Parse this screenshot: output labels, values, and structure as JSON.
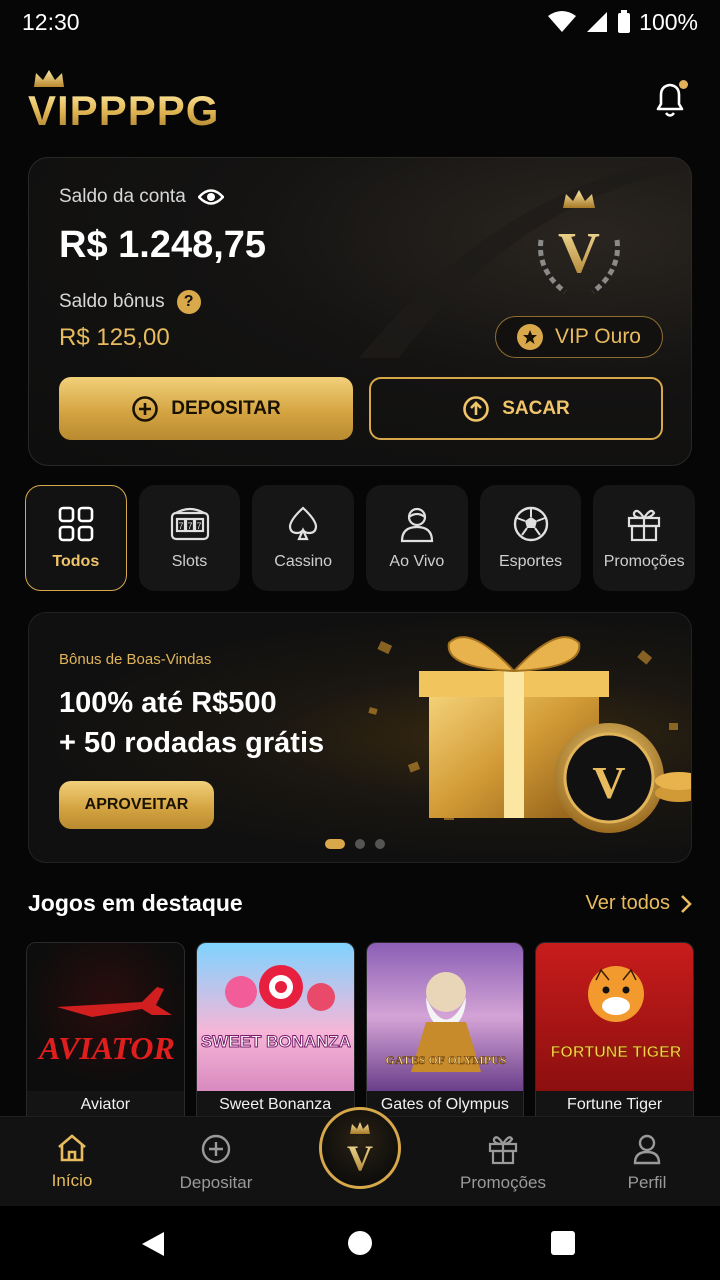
{
  "status_bar": {
    "time": "12:30",
    "battery": "100%"
  },
  "header": {
    "logo": "VIPPPPG",
    "notification_icon": "bell-icon"
  },
  "balance": {
    "label": "Saldo da conta",
    "value": "R$ 1.248,75",
    "bonus_label": "Saldo bônus",
    "bonus_help": "?",
    "bonus_value": "R$ 125,00",
    "vip_level": "VIP Ouro",
    "emblem_letter": "V",
    "deposit_label": "DEPOSITAR",
    "withdraw_label": "SACAR"
  },
  "categories": [
    {
      "label": "Todos",
      "icon": "grid-icon",
      "active": true
    },
    {
      "label": "Slots",
      "icon": "slot-machine-icon",
      "active": false
    },
    {
      "label": "Cassino",
      "icon": "spade-icon",
      "active": false
    },
    {
      "label": "Ao Vivo",
      "icon": "live-dealer-icon",
      "active": false
    },
    {
      "label": "Esportes",
      "icon": "soccer-ball-icon",
      "active": false
    },
    {
      "label": "Promoções",
      "icon": "gift-icon",
      "active": false
    }
  ],
  "banner": {
    "kicker": "Bônus de Boas-Vindas",
    "title_line1": "100% até R$500",
    "title_line2": "+ 50 rodadas grátis",
    "cta": "APROVEITAR",
    "slides_total": 3,
    "active_slide": 1
  },
  "featured": {
    "title": "Jogos em destaque",
    "see_all": "Ver todos",
    "games": [
      {
        "name": "Aviator",
        "art": "AVIATOR"
      },
      {
        "name": "Sweet Bonanza",
        "art": "SWEET BONANZA"
      },
      {
        "name": "Gates of Olympus",
        "art": "GATES OF OLYMPUS"
      },
      {
        "name": "Fortune Tiger",
        "art": "FORTUNE TIGER"
      }
    ]
  },
  "bottom_nav": {
    "home": "Início",
    "deposit": "Depositar",
    "promotions": "Promoções",
    "profile": "Perfil",
    "center_letter": "V"
  },
  "colors": {
    "gold": "#d9a84a",
    "gold_light": "#f2d07a",
    "background": "#060606"
  }
}
